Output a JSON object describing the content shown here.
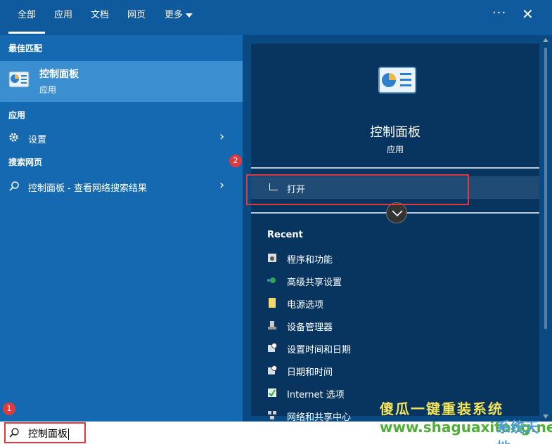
{
  "tabs": [
    {
      "label": "全部"
    },
    {
      "label": "应用"
    },
    {
      "label": "文档"
    },
    {
      "label": "网页"
    },
    {
      "label": "更多"
    }
  ],
  "header": {
    "more_options": "···",
    "close": "✕"
  },
  "left": {
    "best_match_title": "最佳匹配",
    "best_match": {
      "name": "控制面板",
      "type": "应用"
    },
    "apps_title": "应用",
    "apps": [
      {
        "label": "设置"
      }
    ],
    "web_title": "搜索网页",
    "web_results": [
      {
        "label": "控制面板 - 查看网络搜索结果"
      }
    ]
  },
  "detail": {
    "name": "控制面板",
    "type": "应用",
    "open_label": "打开",
    "recent_title": "Recent",
    "recent": [
      {
        "label": "程序和功能",
        "icon": "programs-icon"
      },
      {
        "label": "高级共享设置",
        "icon": "network-share-icon"
      },
      {
        "label": "电源选项",
        "icon": "power-icon"
      },
      {
        "label": "设备管理器",
        "icon": "device-manager-icon"
      },
      {
        "label": "设置时间和日期",
        "icon": "clock-icon"
      },
      {
        "label": "日期和时间",
        "icon": "calendar-icon"
      },
      {
        "label": "Internet 选项",
        "icon": "internet-icon"
      },
      {
        "label": "网络和共享中心",
        "icon": "network-center-icon"
      }
    ]
  },
  "search": {
    "value": "控制面板"
  },
  "annotations": {
    "badge1": "1",
    "badge2": "2"
  },
  "watermark": {
    "line1": "傻瓜一键重装系统",
    "line2": "www.shaguaxitong.net",
    "logo": "系统天地"
  },
  "colors": {
    "accent": "#0f5a9c",
    "highlight": "#3b8fd1",
    "annotation": "#e0393e"
  }
}
